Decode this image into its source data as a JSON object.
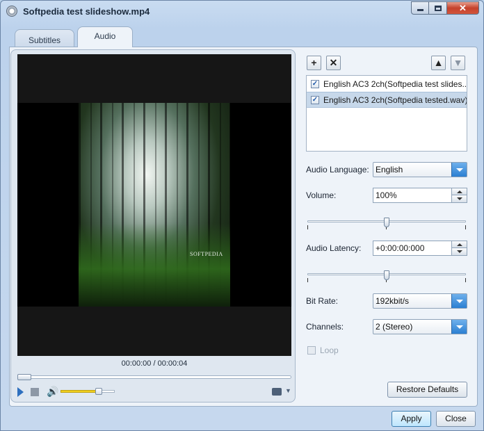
{
  "window": {
    "title": "Softpedia test slideshow.mp4",
    "controls": {
      "minimize_icon": "minimize-icon",
      "maximize_icon": "maximize-icon",
      "close_glyph": "✕"
    }
  },
  "tabs": [
    {
      "label": "Subtitles",
      "active": false
    },
    {
      "label": "Audio",
      "active": true
    }
  ],
  "preview": {
    "watermark_text": "SOFTPEDIA",
    "time": "00:00:00 / 00:00:04",
    "seek_position": 0.0,
    "volume_level": 0.7,
    "icons": [
      "play-icon",
      "stop-icon",
      "volume-icon",
      "snapshot-icon"
    ]
  },
  "toolbar": {
    "add": "+",
    "remove": "✕",
    "move_up": "▲",
    "move_down": "▼"
  },
  "tracks": [
    {
      "label": "English AC3 2ch(Softpedia test slides...",
      "checked": true,
      "selected": false
    },
    {
      "label": "English AC3 2ch(Softpedia tested.wav)",
      "checked": true,
      "selected": true
    }
  ],
  "settings": {
    "audio_language": {
      "label": "Audio Language:",
      "value": "English"
    },
    "volume": {
      "label": "Volume:",
      "value": "100%",
      "slider_position": 0.5
    },
    "audio_latency": {
      "label": "Audio Latency:",
      "value": "+0:00:00:000",
      "slider_position": 0.5
    },
    "bit_rate": {
      "label": "Bit Rate:",
      "value": "192kbit/s"
    },
    "channels": {
      "label": "Channels:",
      "value": "2 (Stereo)"
    },
    "loop": {
      "label": "Loop",
      "checked": false,
      "enabled": false
    }
  },
  "buttons": {
    "restore_defaults": "Restore Defaults",
    "apply": "Apply",
    "close": "Close"
  },
  "colors": {
    "accent": "#2b7fd2",
    "volume_fill": "#f0d020",
    "close_button": "#c5422c"
  }
}
